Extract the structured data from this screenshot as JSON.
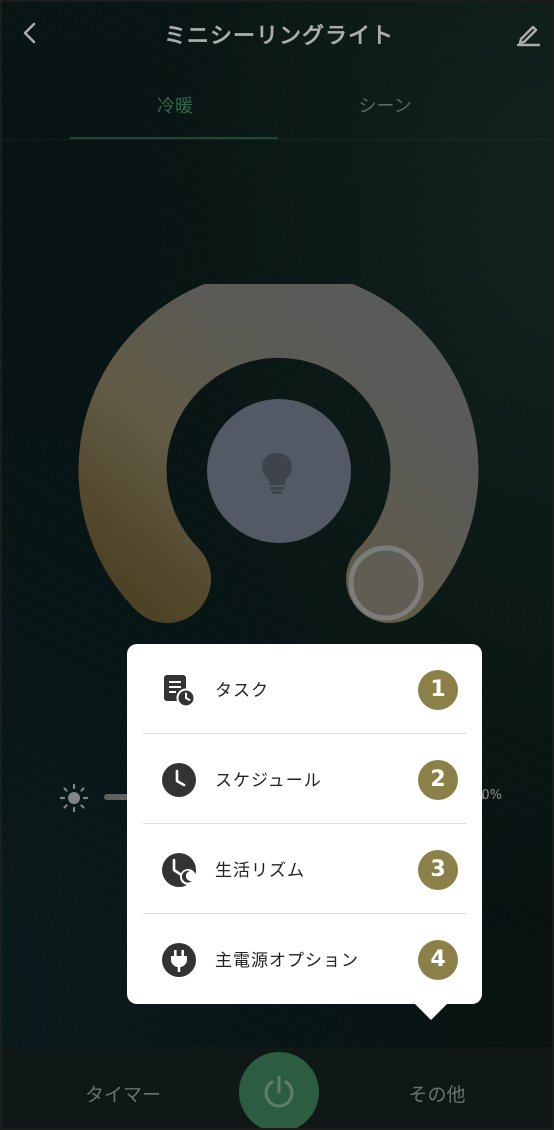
{
  "header": {
    "title": "ミニシーリングライト"
  },
  "tabs": [
    {
      "label": "冷暖",
      "active": true
    },
    {
      "label": "シーン",
      "active": false
    }
  ],
  "brightness": {
    "value_text": "0%"
  },
  "menu": {
    "items": [
      {
        "label": "タスク",
        "badge": "1",
        "icon": "task-icon"
      },
      {
        "label": "スケジュール",
        "badge": "2",
        "icon": "clock-icon"
      },
      {
        "label": "生活リズム",
        "badge": "3",
        "icon": "rhythm-icon"
      },
      {
        "label": "主電源オプション",
        "badge": "4",
        "icon": "plug-icon"
      }
    ]
  },
  "bottom_bar": {
    "timer_label": "タイマー",
    "other_label": "その他"
  },
  "colors": {
    "accent": "#4b9a6a",
    "badge": "#8b8148",
    "power": "#3c7d57"
  }
}
